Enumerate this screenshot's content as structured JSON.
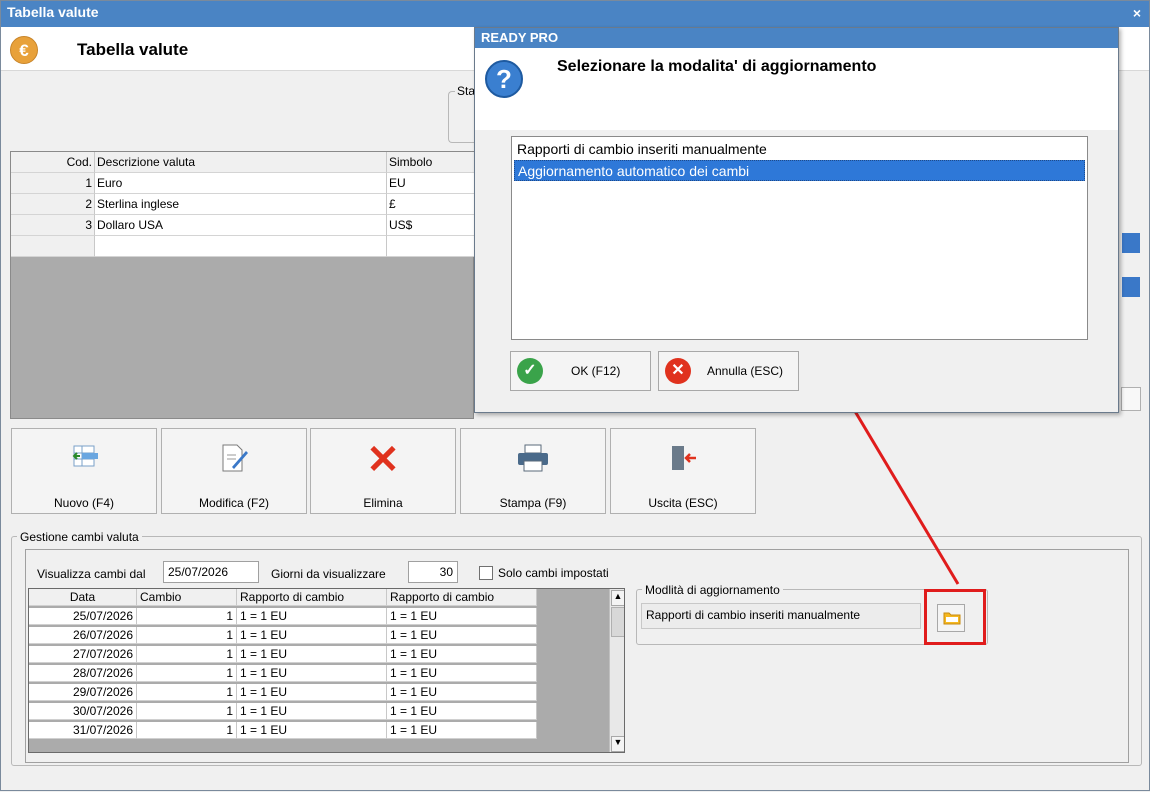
{
  "window": {
    "title": "Tabella valute",
    "close": "×",
    "header_title": "Tabella valute",
    "euro_symbol": "€",
    "status_group_label": "Sta"
  },
  "currency_grid": {
    "headers": [
      "Cod.",
      "Descrizione valuta",
      "Simbolo"
    ],
    "rows": [
      {
        "cod": "1",
        "desc": "Euro",
        "sym": "EU"
      },
      {
        "cod": "2",
        "desc": "Sterlina inglese",
        "sym": "£"
      },
      {
        "cod": "3",
        "desc": "Dollaro USA",
        "sym": "US$"
      }
    ]
  },
  "toolbar": {
    "nuovo": "Nuovo (F4)",
    "modifica": "Modifica (F2)",
    "elimina": "Elimina",
    "stampa": "Stampa (F9)",
    "uscita": "Uscita (ESC)"
  },
  "exchange": {
    "group_label": "Gestione cambi valuta",
    "from_label": "Visualizza cambi dal",
    "from_value": "25/07/2026",
    "days_label": "Giorni da visualizzare",
    "days_value": "30",
    "only_set_label": "Solo cambi impostati",
    "headers": [
      "Data",
      "Cambio",
      "Rapporto di cambio",
      "Rapporto di cambio"
    ],
    "rows": [
      {
        "date": "25/07/2026",
        "cambio": "1",
        "r1": "1  = 1 EU",
        "r2": "1  = 1 EU"
      },
      {
        "date": "26/07/2026",
        "cambio": "1",
        "r1": "1  = 1 EU",
        "r2": "1  = 1 EU"
      },
      {
        "date": "27/07/2026",
        "cambio": "1",
        "r1": "1  = 1 EU",
        "r2": "1  = 1 EU"
      },
      {
        "date": "28/07/2026",
        "cambio": "1",
        "r1": "1  = 1 EU",
        "r2": "1  = 1 EU"
      },
      {
        "date": "29/07/2026",
        "cambio": "1",
        "r1": "1  = 1 EU",
        "r2": "1  = 1 EU"
      },
      {
        "date": "30/07/2026",
        "cambio": "1",
        "r1": "1  = 1 EU",
        "r2": "1  = 1 EU"
      },
      {
        "date": "31/07/2026",
        "cambio": "1",
        "r1": "1  = 1 EU",
        "r2": "1  = 1 EU"
      }
    ],
    "mode_label": "Modlità di aggiornamento",
    "mode_value": "Rapporti di cambio inseriti manualmente"
  },
  "dialog": {
    "title": "READY PRO",
    "question_icon": "?",
    "question": "Selezionare la modalita' di aggiornamento",
    "options": [
      "Rapporti di cambio inseriti manualmente",
      "Aggiornamento automatico dei cambi"
    ],
    "ok": "OK (F12)",
    "cancel": "Annulla (ESC)",
    "ok_icon": "✓",
    "cancel_icon": "✕"
  },
  "colors": {
    "accent": "#4a84c4",
    "selection": "#2e78d8",
    "highlight": "#e01c1c"
  }
}
